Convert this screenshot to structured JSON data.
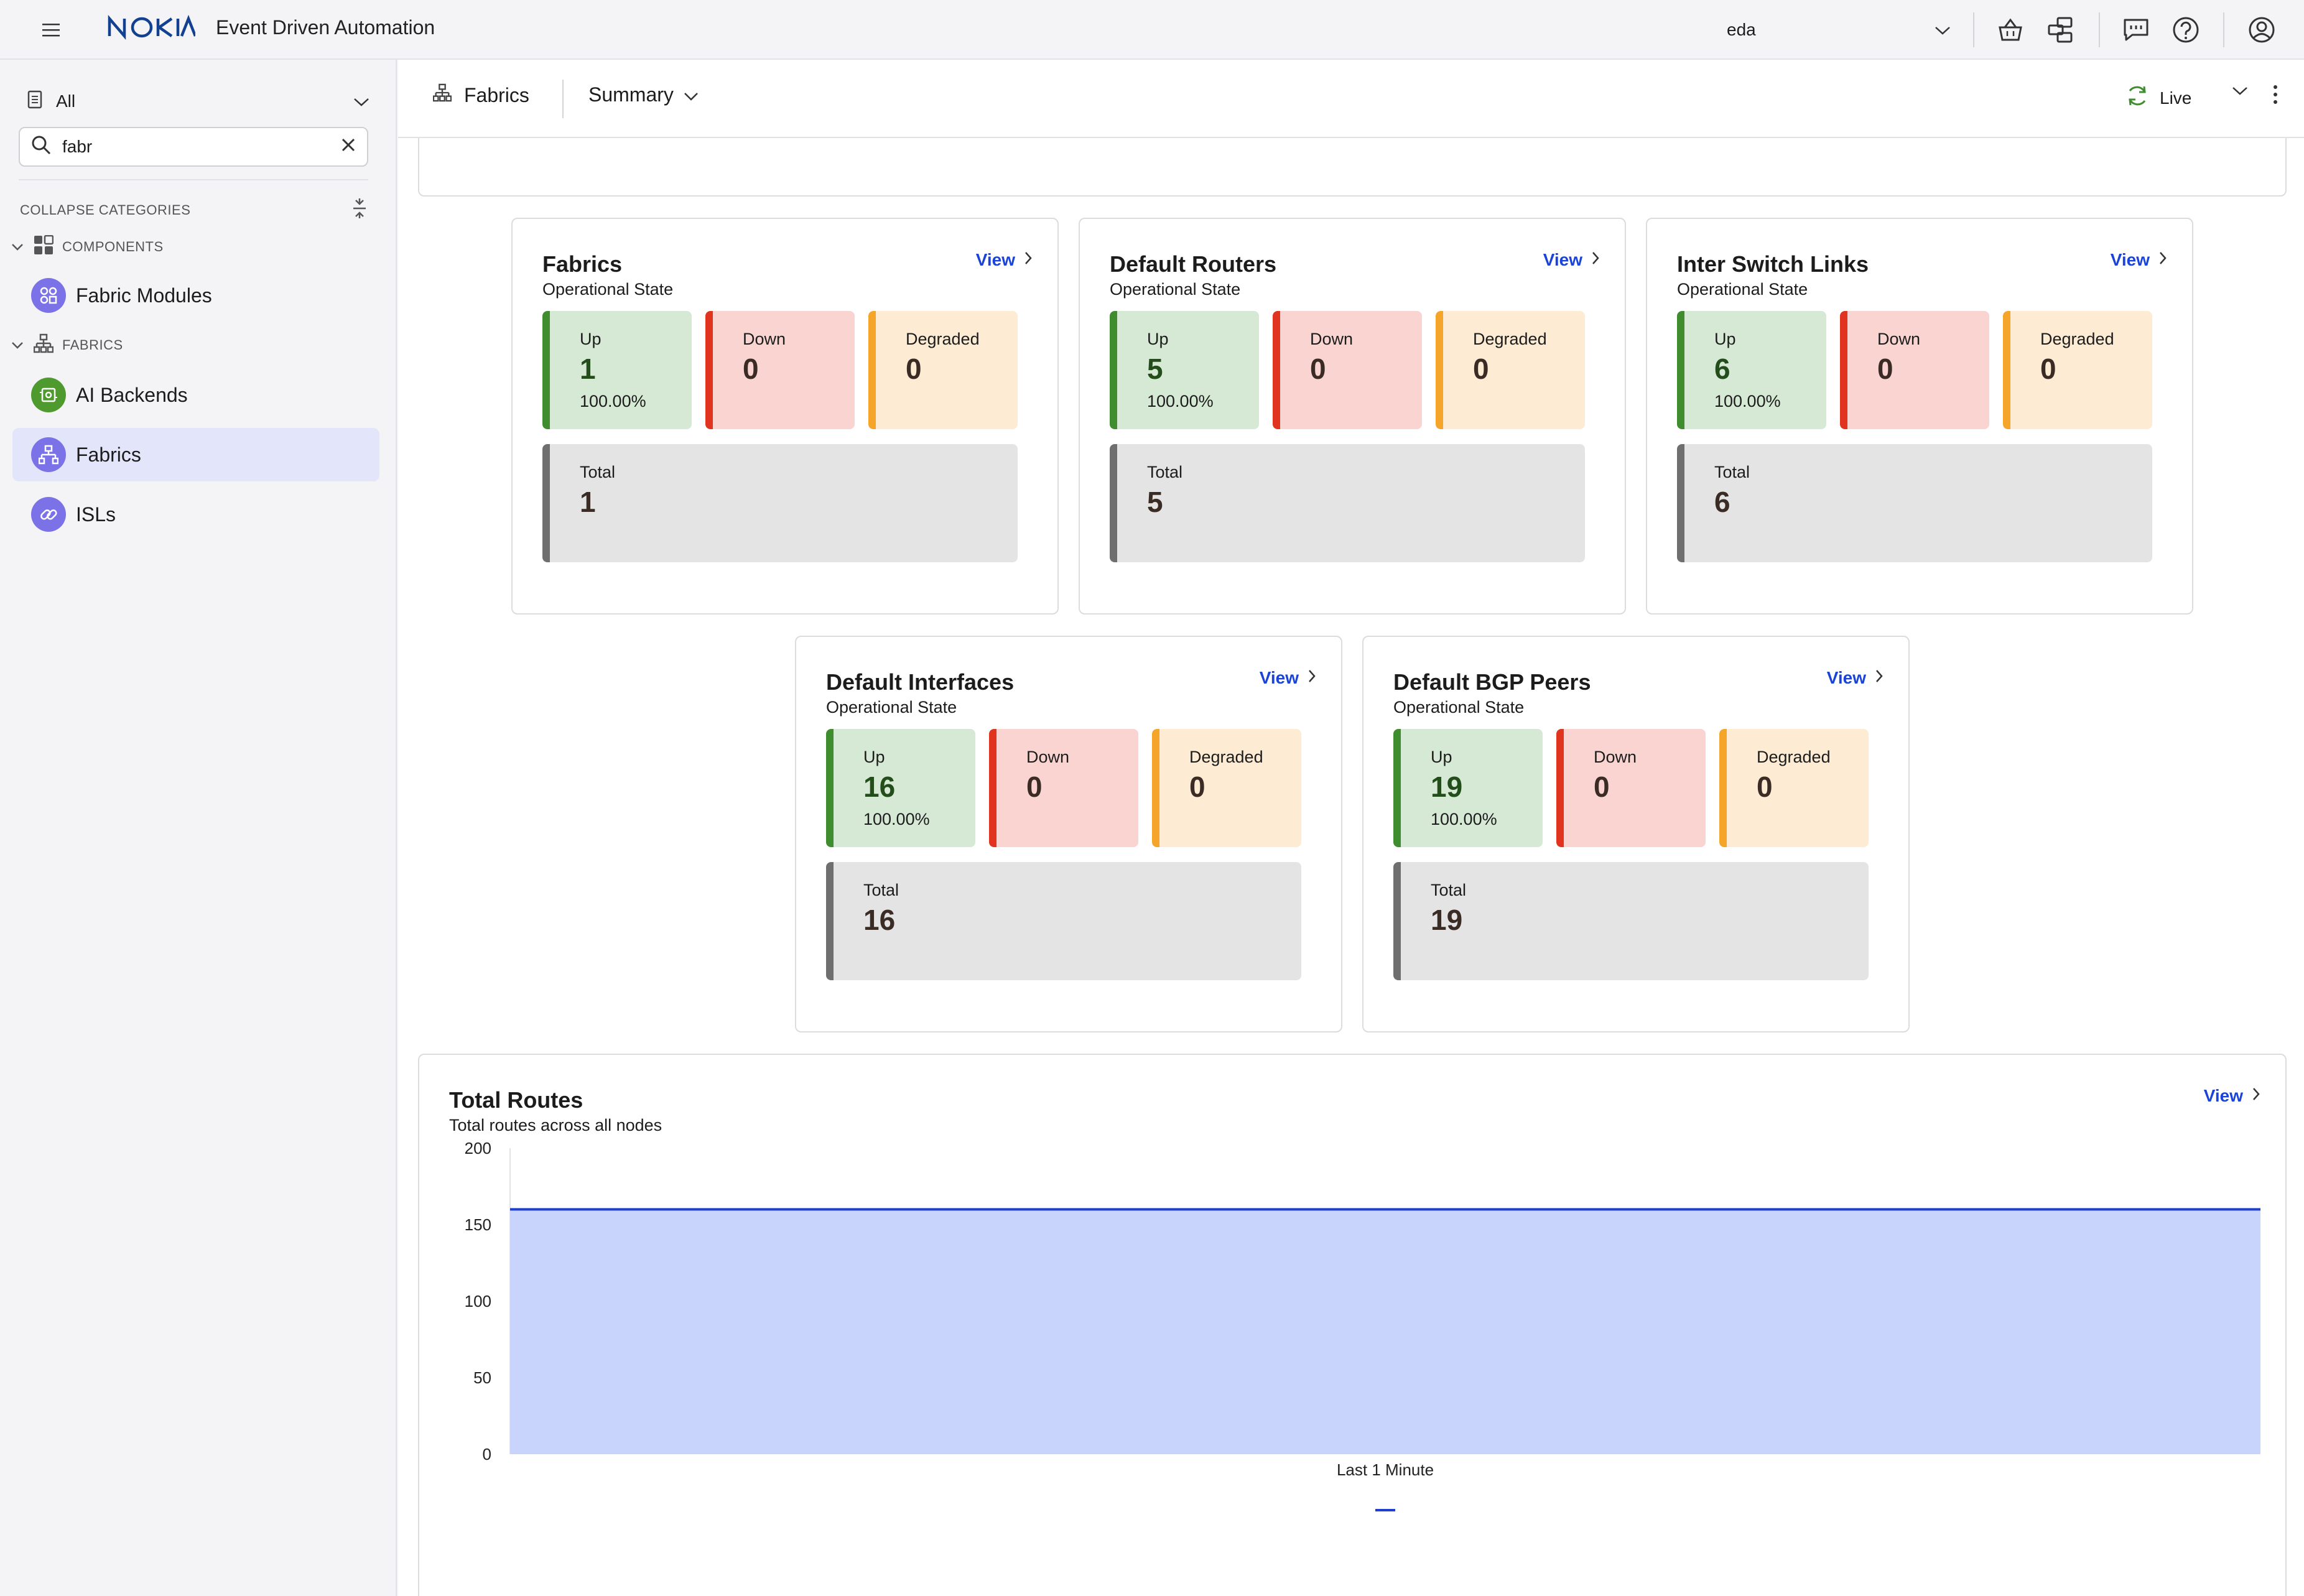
{
  "header": {
    "app_title": "Event Driven Automation",
    "namespace": "eda",
    "icons": [
      "menu-icon",
      "basket-icon",
      "workflow-icon",
      "chat-icon",
      "help-icon",
      "user-icon"
    ]
  },
  "sidebar": {
    "filter_label": "All",
    "search_value": "fabr",
    "collapse_label": "COLLAPSE CATEGORIES",
    "categories": [
      {
        "label": "COMPONENTS",
        "items": [
          {
            "label": "Fabric Modules"
          }
        ]
      },
      {
        "label": "FABRICS",
        "items": [
          {
            "label": "AI Backends"
          },
          {
            "label": "Fabrics"
          },
          {
            "label": "ISLs"
          }
        ]
      }
    ],
    "active_item": "Fabrics"
  },
  "content_header": {
    "crumb": "Fabrics",
    "view": "Summary",
    "live": "Live"
  },
  "labels": {
    "up": "Up",
    "down": "Down",
    "degraded": "Degraded",
    "total": "Total",
    "view": "View"
  },
  "cards": [
    {
      "title": "Fabrics",
      "subtitle": "Operational State",
      "up": "1",
      "up_pct": "100.00%",
      "down": "0",
      "degraded": "0",
      "total": "1"
    },
    {
      "title": "Default Routers",
      "subtitle": "Operational State",
      "up": "5",
      "up_pct": "100.00%",
      "down": "0",
      "degraded": "0",
      "total": "5"
    },
    {
      "title": "Inter Switch Links",
      "subtitle": "Operational State",
      "up": "6",
      "up_pct": "100.00%",
      "down": "0",
      "degraded": "0",
      "total": "6"
    },
    {
      "title": "Default Interfaces",
      "subtitle": "Operational State",
      "up": "16",
      "up_pct": "100.00%",
      "down": "0",
      "degraded": "0",
      "total": "16"
    },
    {
      "title": "Default BGP Peers",
      "subtitle": "Operational State",
      "up": "19",
      "up_pct": "100.00%",
      "down": "0",
      "degraded": "0",
      "total": "19"
    }
  ],
  "total_routes": {
    "title": "Total Routes",
    "subtitle": "Total routes across all nodes",
    "view": "View"
  },
  "colors": {
    "brand": "#124191",
    "link": "#1a44d9",
    "up": "#3f8d2f",
    "down": "#e0341f",
    "degraded": "#f4a52a",
    "area_fill": "#c9d4fd",
    "area_line": "#1f3fd1"
  },
  "chart_data": {
    "type": "area",
    "title": "Total Routes",
    "subtitle": "Total routes across all nodes",
    "xlabel": "Last 1 Minute",
    "ylabel": "",
    "ylim": [
      0,
      200
    ],
    "yticks": [
      0,
      50,
      100,
      150,
      200
    ],
    "series": [
      {
        "values": [
          160,
          160
        ]
      }
    ],
    "legend": "bottom",
    "grid": false
  }
}
